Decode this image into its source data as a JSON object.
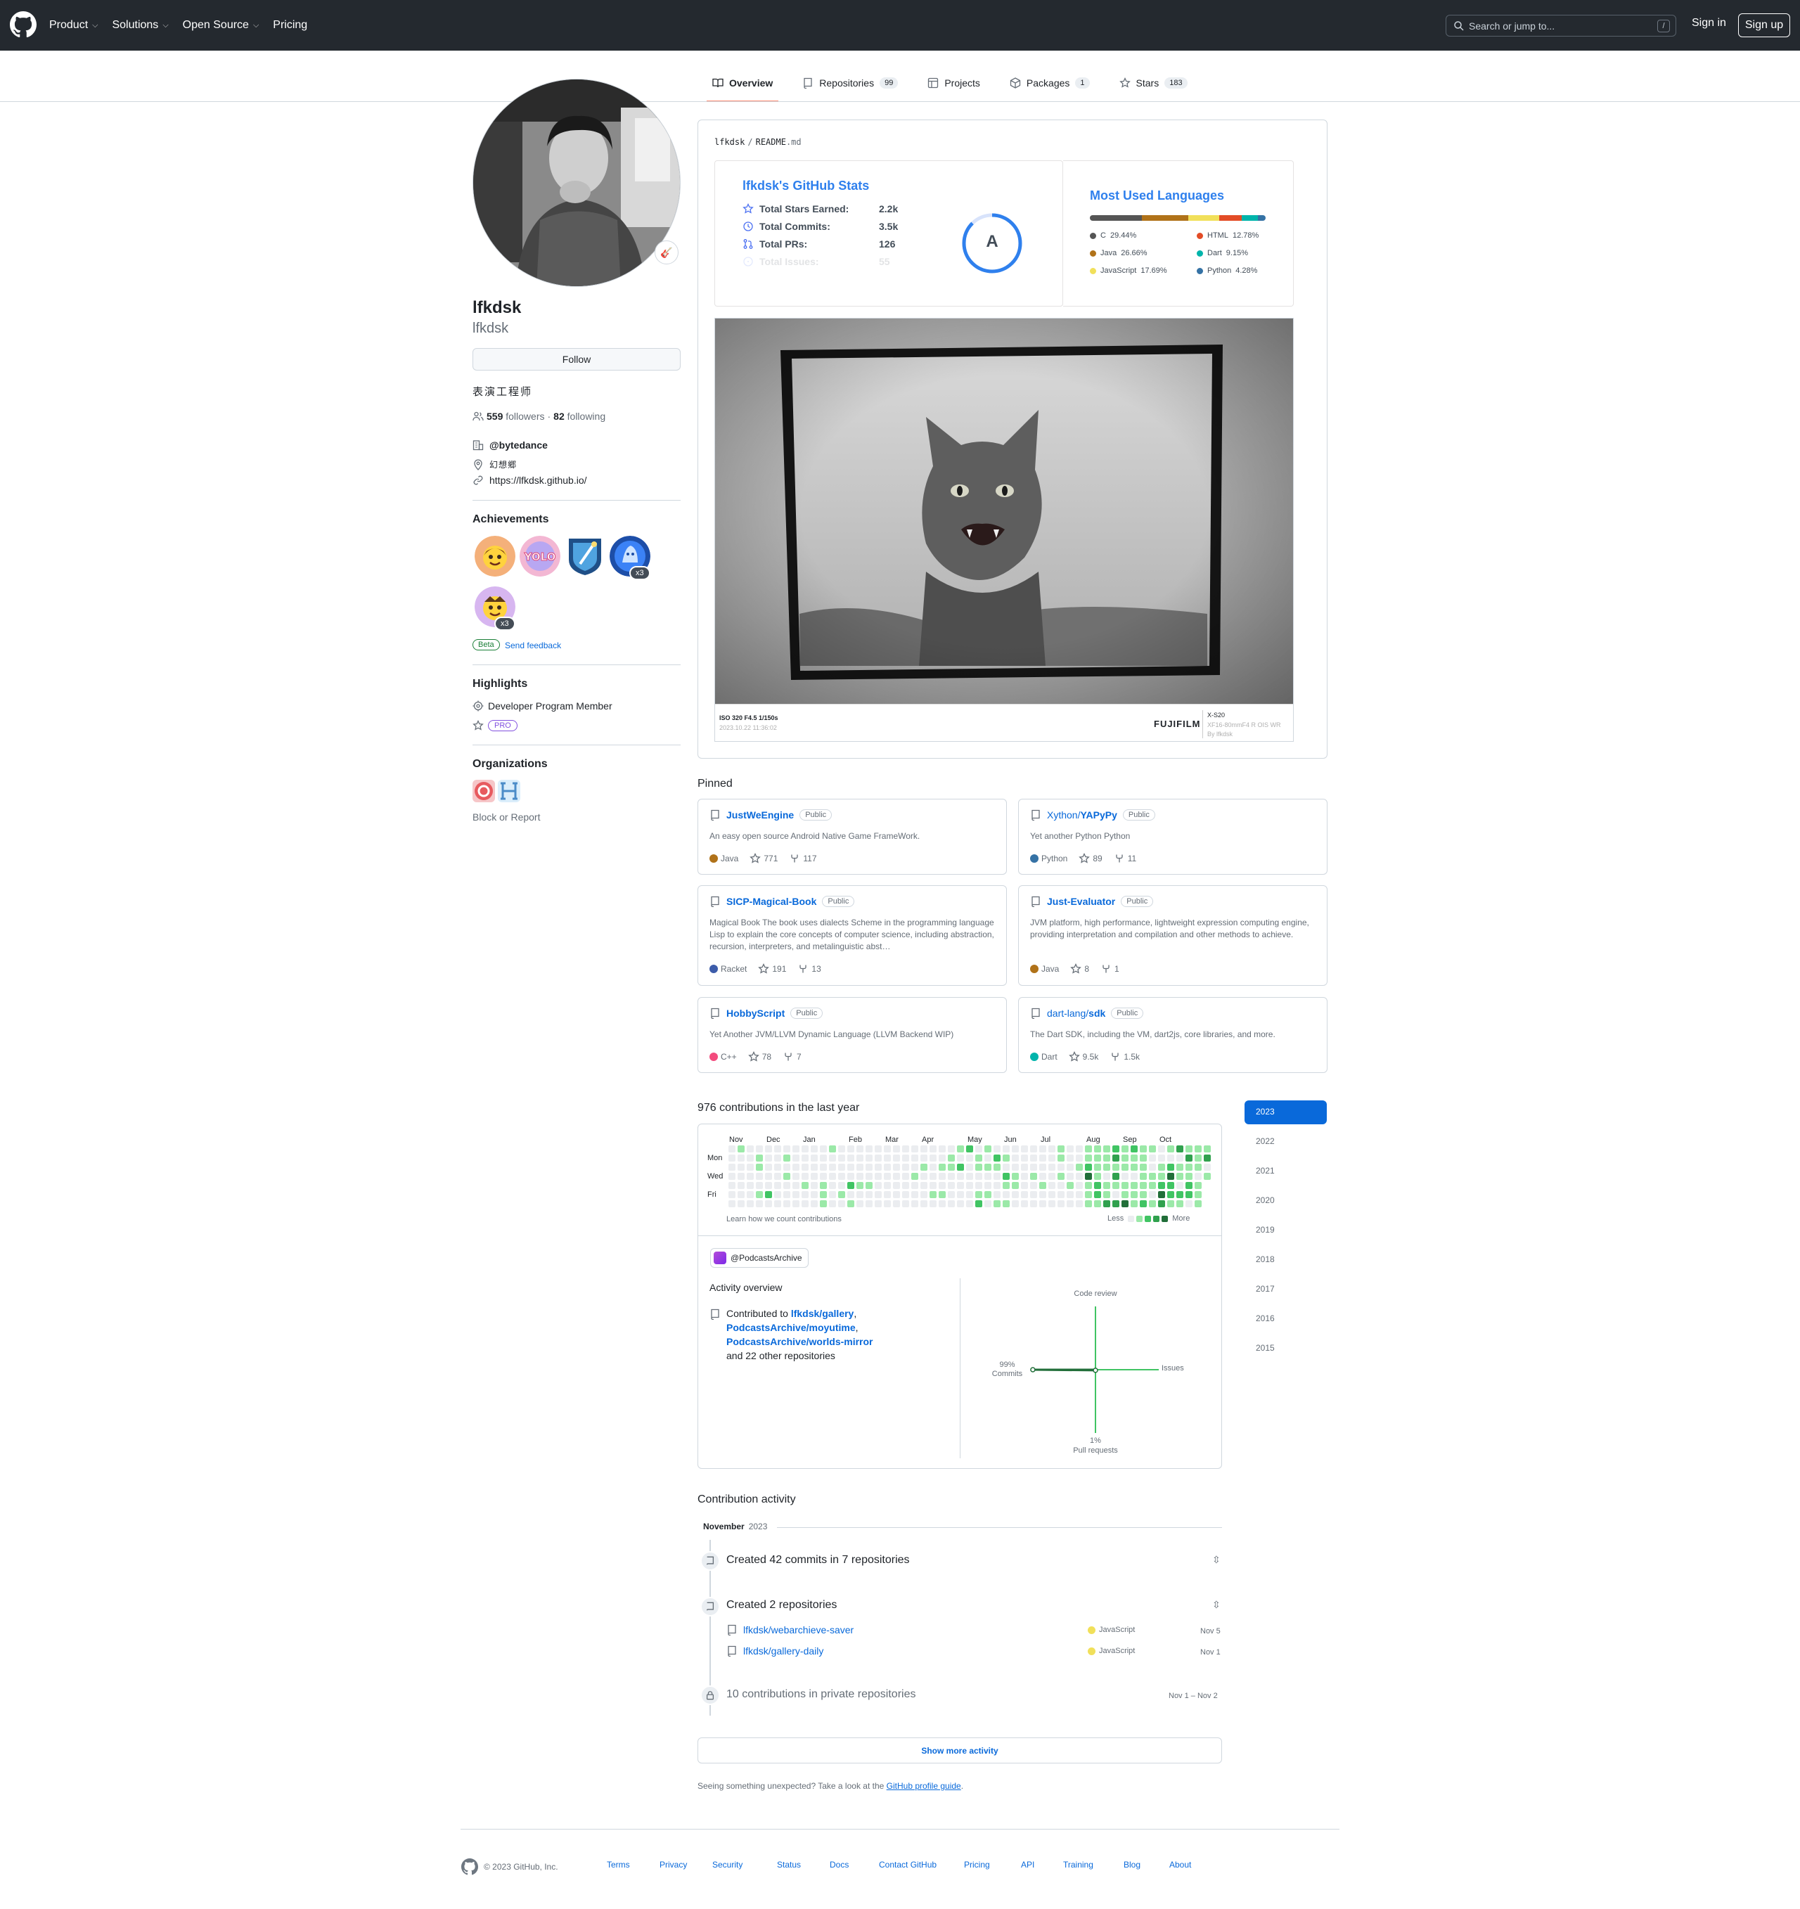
{
  "nav": {
    "items": [
      "Product",
      "Solutions",
      "Open Source",
      "Pricing"
    ],
    "search_placeholder": "Search or jump to...",
    "slash": "/",
    "sign_in": "Sign in",
    "sign_up": "Sign up"
  },
  "tabs": [
    {
      "label": "Overview"
    },
    {
      "label": "Repositories",
      "count": "99"
    },
    {
      "label": "Projects"
    },
    {
      "label": "Packages",
      "count": "1"
    },
    {
      "label": "Stars",
      "count": "183"
    }
  ],
  "profile": {
    "name": "lfkdsk",
    "login": "lfkdsk",
    "follow_label": "Follow",
    "bio": "表演工程师",
    "followers": "559",
    "followers_label": "followers",
    "following": "82",
    "following_label": "following",
    "dot": "·",
    "company": "@bytedance",
    "location": "幻想郷",
    "website": "https://lfkdsk.github.io/",
    "status_emoji": "🎸"
  },
  "achievements": {
    "title": "Achievements",
    "x3_a": "x3",
    "x3_b": "x3",
    "beta": "Beta",
    "feedback": "Send feedback"
  },
  "highlights": {
    "title": "Highlights",
    "member": "Developer Program Member",
    "pro": "PRO"
  },
  "organizations": {
    "title": "Organizations",
    "block": "Block or Report"
  },
  "readme": {
    "path_user": "lfkdsk",
    "path_sep": "/",
    "path_file": "README",
    "path_ext": ".md",
    "stats": {
      "title": "lfkdsk's GitHub Stats",
      "rows": [
        {
          "label": "Total Stars Earned:",
          "value": "2.2k"
        },
        {
          "label": "Total Commits:",
          "value": "3.5k"
        },
        {
          "label": "Total PRs:",
          "value": "126"
        },
        {
          "label": "Total Issues:",
          "value": "55"
        }
      ],
      "grade": "A"
    },
    "languages": {
      "title": "Most Used Languages",
      "items": [
        {
          "name": "C",
          "pct": "29.44%",
          "value": 29.44,
          "color": "#555555"
        },
        {
          "name": "HTML",
          "pct": "12.78%",
          "value": 12.78,
          "color": "#e34c26"
        },
        {
          "name": "Java",
          "pct": "26.66%",
          "value": 26.66,
          "color": "#b07219"
        },
        {
          "name": "Dart",
          "pct": "9.15%",
          "value": 9.15,
          "color": "#00b4ab"
        },
        {
          "name": "JavaScript",
          "pct": "17.69%",
          "value": 17.69,
          "color": "#f1e05a"
        },
        {
          "name": "Python",
          "pct": "4.28%",
          "value": 4.28,
          "color": "#3572a5"
        }
      ]
    },
    "photo": {
      "exif_left": "ISO 320 F4.5 1/150s",
      "exif_date": "2023.10.22 11:36:02",
      "brand": "FUJIFILM",
      "model": "X-S20",
      "lens": "XF16-80mmF4 R OIS WR",
      "by": "By lfkdsk"
    }
  },
  "pinned": {
    "title": "Pinned",
    "items": [
      {
        "owner": "",
        "name": "JustWeEngine",
        "vis": "Public",
        "desc": "An easy open source Android Native Game FrameWork.",
        "lang": "Java",
        "lang_color": "#b07219",
        "stars": "771",
        "forks": "117"
      },
      {
        "owner": "Xython/",
        "name": "YAPyPy",
        "vis": "Public",
        "desc": "Yet another Python Python",
        "lang": "Python",
        "lang_color": "#3572a5",
        "stars": "89",
        "forks": "11"
      },
      {
        "owner": "",
        "name": "SICP-Magical-Book",
        "vis": "Public",
        "desc": "Magical Book The book uses dialects Scheme in the programming language Lisp to explain the core concepts of computer science, including abstraction, recursion, interpreters, and metalinguistic abst…",
        "lang": "Racket",
        "lang_color": "#3c5caa",
        "stars": "191",
        "forks": "13"
      },
      {
        "owner": "",
        "name": "Just-Evaluator",
        "vis": "Public",
        "desc": "JVM platform, high performance, lightweight expression computing engine, providing interpretation and compilation and other methods to achieve.",
        "lang": "Java",
        "lang_color": "#b07219",
        "stars": "8",
        "forks": "1"
      },
      {
        "owner": "",
        "name": "HobbyScript",
        "vis": "Public",
        "desc": "Yet Another JVM/LLVM Dynamic Language (LLVM Backend WIP)",
        "lang": "C++",
        "lang_color": "#f34b7d",
        "stars": "78",
        "forks": "7"
      },
      {
        "owner": "dart-lang/",
        "name": "sdk",
        "vis": "Public",
        "desc": "The Dart SDK, including the VM, dart2js, core libraries, and more.",
        "lang": "Dart",
        "lang_color": "#00b4ab",
        "stars": "9.5k",
        "forks": "1.5k"
      }
    ]
  },
  "contributions": {
    "title": "976 contributions in the last year",
    "months": [
      "Nov",
      "Dec",
      "Jan",
      "Feb",
      "Mar",
      "Apr",
      "May",
      "Jun",
      "Jul",
      "Aug",
      "Sep",
      "Oct"
    ],
    "days": [
      "Mon",
      "Wed",
      "Fri"
    ],
    "learn": "Learn how we count contributions",
    "less": "Less",
    "more": "More",
    "colors": [
      "#ebedf0",
      "#9be9a8",
      "#40c463",
      "#30a14e",
      "#216e39"
    ],
    "years": [
      "2023",
      "2022",
      "2021",
      "2020",
      "2019",
      "2018",
      "2017",
      "2016",
      "2015"
    ]
  },
  "activity_overview": {
    "org": "@PodcastsArchive",
    "title": "Activity overview",
    "contributed_to": "Contributed to",
    "repos": [
      "lfkdsk/gallery",
      "PodcastsArchive/moyutime",
      "PodcastsArchive/worlds-mirror"
    ],
    "comma": ",",
    "others": "and 22 other repositories",
    "axes": {
      "top": "Code review",
      "right": "Issues",
      "left_pct": "99%",
      "left": "Commits",
      "bottom_pct": "1%",
      "bottom": "Pull requests"
    },
    "commits_pct": 99,
    "prs_pct": 1
  },
  "activity": {
    "title": "Contribution activity",
    "month": "November",
    "year": "2023",
    "commits": "Created 42 commits in 7 repositories",
    "created": "Created 2 repositories",
    "repos": [
      {
        "name": "lfkdsk/webarchieve-saver",
        "lang": "JavaScript",
        "date": "Nov 5"
      },
      {
        "name": "lfkdsk/gallery-daily",
        "lang": "JavaScript",
        "date": "Nov 1"
      }
    ],
    "lang_color": "#f1e05a",
    "private": "10 contributions in private repositories",
    "private_date": "Nov 1 – Nov 2",
    "show_more": "Show more activity",
    "unexpected": "Seeing something unexpected? Take a look at the",
    "guide": "GitHub profile guide",
    "period": "."
  },
  "footer": {
    "copyright": "© 2023 GitHub, Inc.",
    "links": [
      "Terms",
      "Privacy",
      "Security",
      "Status",
      "Docs",
      "Contact GitHub",
      "Pricing",
      "API",
      "Training",
      "Blog",
      "About"
    ]
  }
}
